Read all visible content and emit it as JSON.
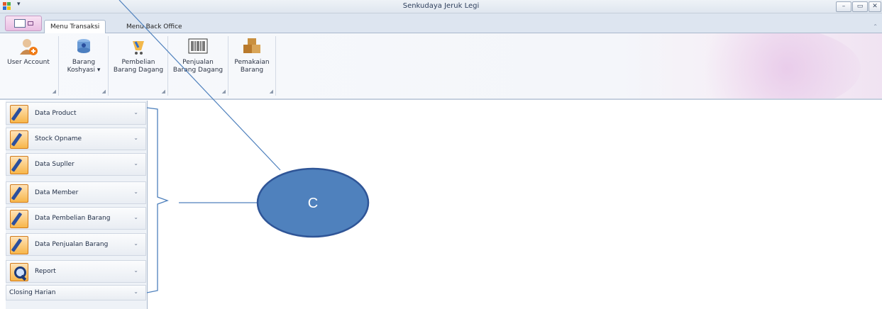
{
  "window": {
    "title": "Senkudaya Jeruk Legi",
    "controls": [
      "–",
      "▭",
      "✕"
    ]
  },
  "tabs": [
    {
      "label": "Menu Transaksi",
      "active": true
    },
    {
      "label": "Menu Back Office",
      "active": false
    }
  ],
  "ribbon": {
    "buttons": [
      {
        "line1": "User Account",
        "line2": "",
        "icon": "user-add-icon"
      },
      {
        "line1": "Barang",
        "line2": "Koshyasi ▾",
        "icon": "database-icon"
      },
      {
        "line1": "Pembelian",
        "line2": "Barang Dagang",
        "icon": "cart-icon"
      },
      {
        "line1": "Penjualan",
        "line2": "Barang Dagang",
        "icon": "barcode-icon"
      },
      {
        "line1": "Pemakaian",
        "line2": "Barang",
        "icon": "boxes-icon"
      }
    ]
  },
  "nav": {
    "groups": [
      {
        "label": "Data Product",
        "icon": "pencil-icon"
      },
      {
        "label": "Stock Opname",
        "icon": "pencil-icon"
      },
      {
        "label": "Data Supller",
        "icon": "pencil-icon"
      },
      {
        "label": "Data Member",
        "icon": "pencil-icon"
      },
      {
        "label": "Data Pembelian Barang",
        "icon": "pencil-icon"
      },
      {
        "label": "Data Penjualan Barang",
        "icon": "pencil-icon"
      },
      {
        "label": "Report",
        "icon": "magnifier-icon"
      },
      {
        "label": "Closing Harian",
        "icon": ""
      }
    ],
    "chevron": "⌄"
  },
  "annotation": {
    "label": "C",
    "color": "#4f81bd"
  }
}
